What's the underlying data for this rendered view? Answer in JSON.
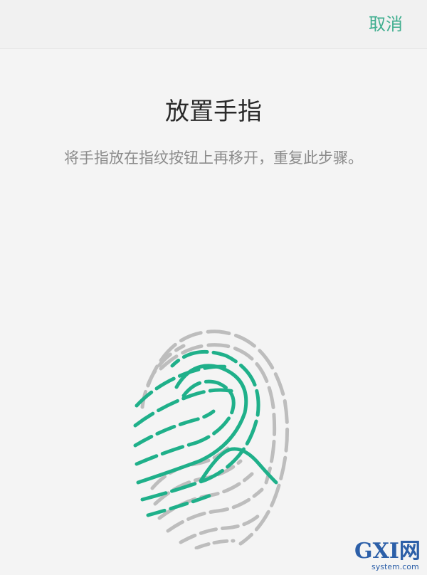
{
  "header": {
    "cancel_label": "取消"
  },
  "main": {
    "title": "放置手指",
    "instruction": "将手指放在指纹按钮上再移开，重复此步骤。",
    "fingerprint": {
      "icon": "fingerprint-icon",
      "progress_color": "#1fb08a",
      "idle_color": "#bdbdbd"
    }
  },
  "watermark": {
    "brand": "GXI网",
    "domain": "system.com"
  },
  "colors": {
    "accent": "#3fae8f",
    "background": "#f4f4f4"
  }
}
